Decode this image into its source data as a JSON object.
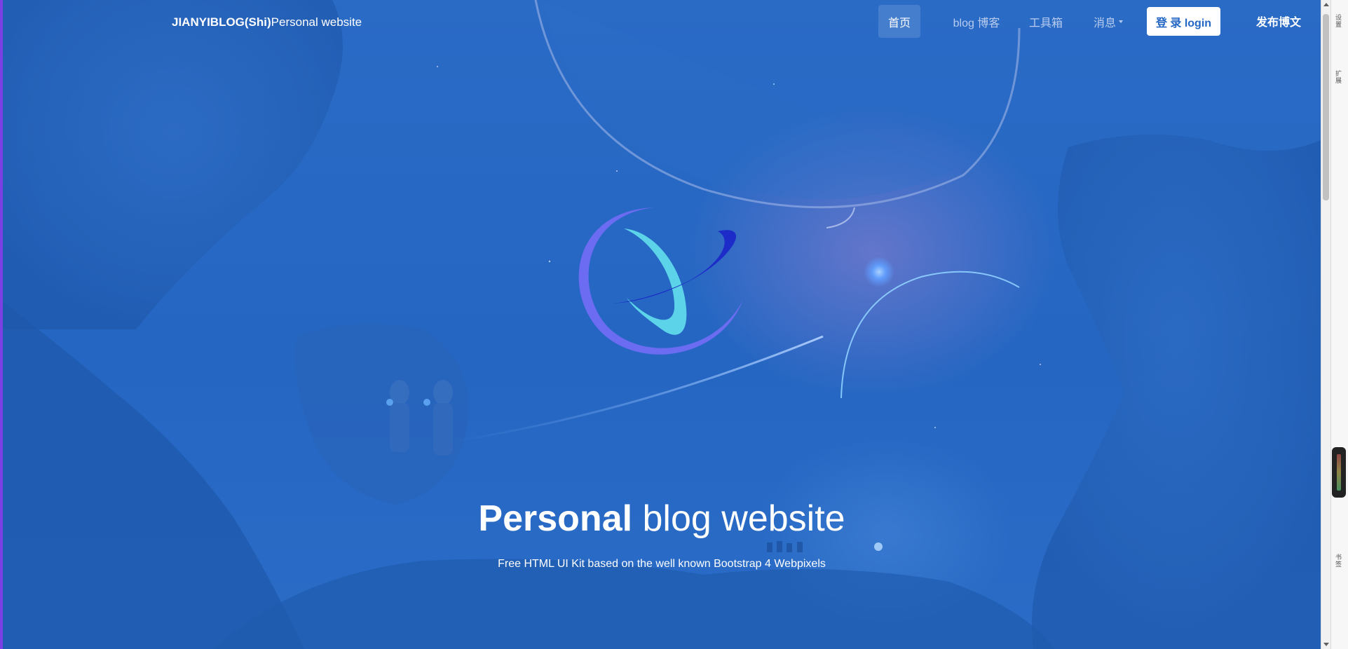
{
  "navbar": {
    "brand_bold": "JIANYIBLOG(Shi)",
    "brand_rest": "Personal website",
    "items": [
      {
        "label": "首页",
        "active": true
      },
      {
        "label": "blog 博客",
        "active": false
      },
      {
        "label": "工具箱",
        "active": false
      },
      {
        "label": "消息",
        "active": false,
        "dropdown": true
      }
    ],
    "login_label": "登 录 login",
    "publish_label": "发布博文"
  },
  "hero": {
    "title_strong": "Personal",
    "title_rest": "blog website",
    "subtitle": "Free HTML UI Kit based on the well known Bootstrap 4 Webpixels"
  },
  "side_panel": {
    "tabs": [
      "设置",
      "扩展",
      "书签"
    ]
  },
  "colors": {
    "hero_blue": "#2467c4",
    "logo_purple": "#6b6cf2",
    "logo_cyan": "#5cd3e8",
    "logo_navy": "#1d2bc8",
    "accent_edge": "#7b3fe4"
  }
}
